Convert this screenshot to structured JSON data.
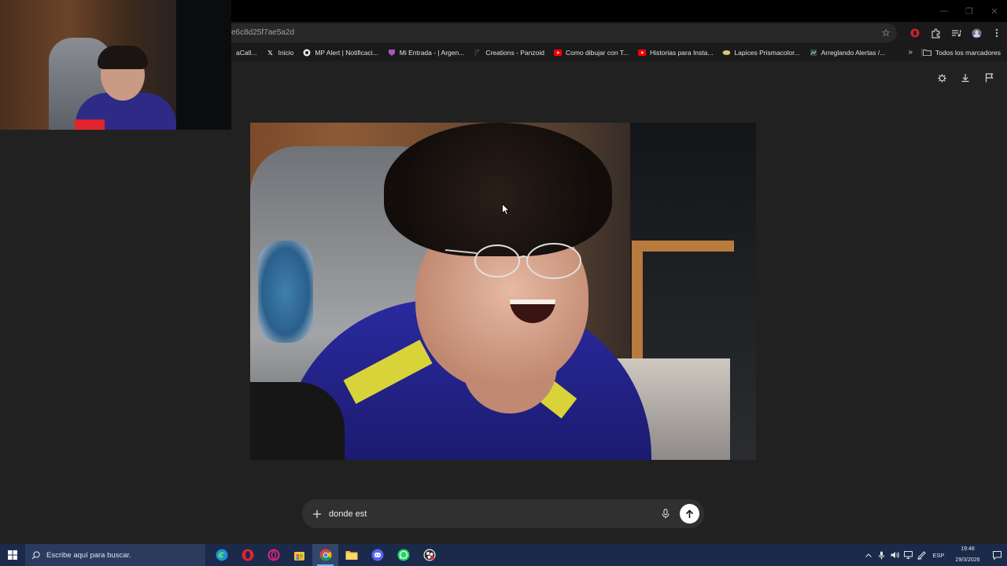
{
  "window": {
    "minimize": "—",
    "restore": "❐",
    "close": "✕"
  },
  "browser": {
    "url": "e6c8d25f7ae5a2d",
    "bookmarks": [
      {
        "label": "aCall...",
        "icon": ""
      },
      {
        "label": "Inicio",
        "icon": "x-logo-icon"
      },
      {
        "label": "MP Alert | Notificaci...",
        "icon": "mp-icon"
      },
      {
        "label": "Mi Entrada - | Argen...",
        "icon": "ticket-icon"
      },
      {
        "label": "Creations - Panzoid",
        "icon": "panzoid-icon"
      },
      {
        "label": "Como dibujar con T...",
        "icon": "youtube-icon"
      },
      {
        "label": "Historias para Insta...",
        "icon": "youtube-icon"
      },
      {
        "label": "Lapices Prismacolor...",
        "icon": "pencil-icon"
      },
      {
        "label": "Arreglando Alertas /...",
        "icon": "page-icon"
      }
    ],
    "more": "»",
    "all_bookmarks": "Todos los marcadores"
  },
  "chat": {
    "input_value": "donde est"
  },
  "taskbar": {
    "search_placeholder": "Escribe aquí para buscar.",
    "language": "ESP",
    "time": "19:48",
    "date": "29/3/2026"
  }
}
